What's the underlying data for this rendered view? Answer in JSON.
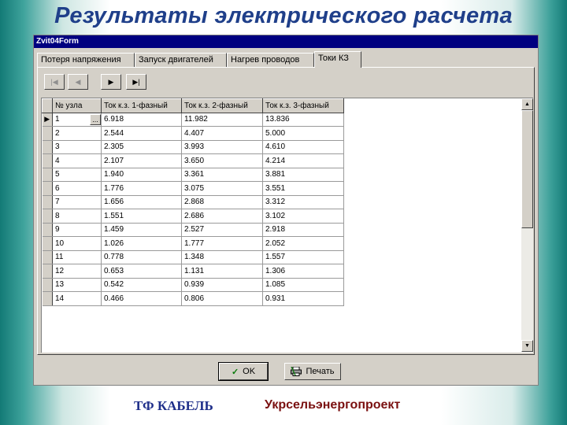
{
  "slide": {
    "title": "Результаты электрического расчета",
    "footer_left": "ТФ КАБЕЛЬ",
    "footer_right": "Укрсельэнергопроект"
  },
  "window": {
    "title": "Zvit04Form"
  },
  "tabs": [
    {
      "label": "Потеря напряжения",
      "active": false
    },
    {
      "label": "Запуск двигателей",
      "active": false
    },
    {
      "label": "Нагрев проводов",
      "active": false
    },
    {
      "label": "Токи КЗ",
      "active": true
    }
  ],
  "navigator": {
    "buttons": [
      "first",
      "prior",
      "next",
      "last"
    ],
    "icons": [
      "first-record-icon",
      "prior-record-icon",
      "next-record-icon",
      "last-record-icon"
    ]
  },
  "grid": {
    "columns": [
      "№ узла",
      "Ток к.з. 1-фазный",
      "Ток к.з. 2-фазный",
      "Ток к.з. 3-фазный"
    ],
    "rows": [
      [
        "1",
        "6.918",
        "11.982",
        "13.836"
      ],
      [
        "2",
        "2.544",
        "4.407",
        "5.000"
      ],
      [
        "3",
        "2.305",
        "3.993",
        "4.610"
      ],
      [
        "4",
        "2.107",
        "3.650",
        "4.214"
      ],
      [
        "5",
        "1.940",
        "3.361",
        "3.881"
      ],
      [
        "6",
        "1.776",
        "3.075",
        "3.551"
      ],
      [
        "7",
        "1.656",
        "2.868",
        "3.312"
      ],
      [
        "8",
        "1.551",
        "2.686",
        "3.102"
      ],
      [
        "9",
        "1.459",
        "2.527",
        "2.918"
      ],
      [
        "10",
        "1.026",
        "1.777",
        "2.052"
      ],
      [
        "11",
        "0.778",
        "1.348",
        "1.557"
      ],
      [
        "12",
        "0.653",
        "1.131",
        "1.306"
      ],
      [
        "13",
        "0.542",
        "0.939",
        "1.085"
      ],
      [
        "14",
        "0.466",
        "0.806",
        "0.931"
      ]
    ],
    "current_row_marker": "▶",
    "ellipsis": "..."
  },
  "buttons": {
    "ok": "OK",
    "print": "Печать"
  },
  "colors": {
    "title": "#1f3f8a",
    "footer_left": "#1f2f8a",
    "footer_right": "#7a1010",
    "window_face": "#d4d0c8",
    "titlebar": "#000080"
  }
}
